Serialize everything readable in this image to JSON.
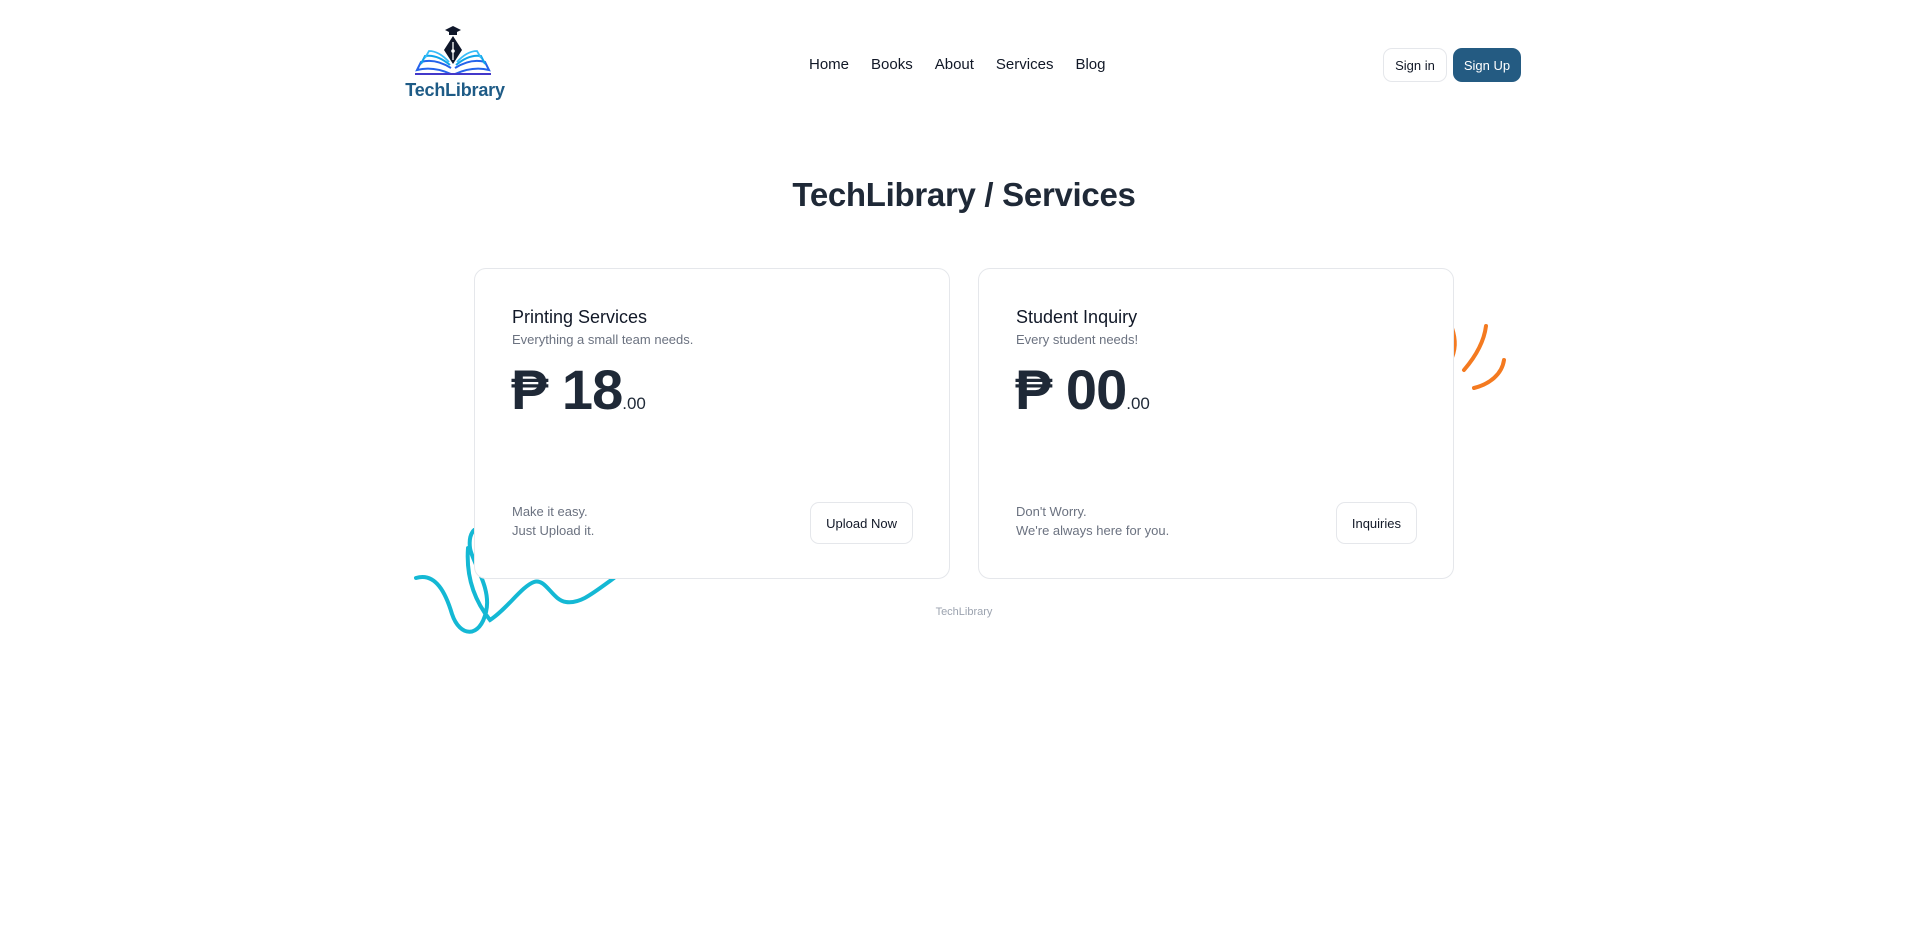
{
  "header": {
    "logo_text": "TechLibrary",
    "nav": [
      {
        "label": "Home"
      },
      {
        "label": "Books"
      },
      {
        "label": "About"
      },
      {
        "label": "Services"
      },
      {
        "label": "Blog"
      }
    ],
    "sign_in_label": "Sign in",
    "sign_up_label": "Sign Up"
  },
  "page_title": "TechLibrary / Services",
  "cards": [
    {
      "title": "Printing Services",
      "subtitle": "Everything a small team needs.",
      "currency": "₱",
      "price_main": "18",
      "price_cents": ".00",
      "note_lines": [
        "Make it easy.",
        "Just Upload it."
      ],
      "button_label": "Upload Now"
    },
    {
      "title": "Student Inquiry",
      "subtitle": "Every student needs!",
      "currency": "₱",
      "price_main": "00",
      "price_cents": ".00",
      "note_lines": [
        "Don't Worry.",
        "We're always here for you."
      ],
      "button_label": "Inquiries"
    }
  ],
  "footer_text": "TechLibrary",
  "colors": {
    "brand": "#245b82",
    "logo_text": "#1e5b86",
    "deco_teal": "#14b8d4",
    "deco_orange": "#f47a20",
    "text_dark": "#1f2937",
    "text_muted": "#6b7280"
  },
  "icons": {
    "logo": "open-book-pen-nib-graduation-cap-icon"
  }
}
